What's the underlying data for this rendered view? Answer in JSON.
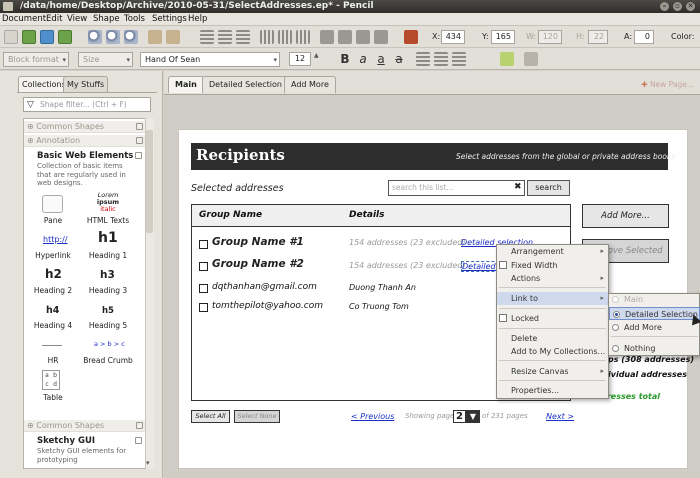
{
  "titlebar": {
    "title": "/data/home/Desktop/Archive/2010-05-31/SelectAddresses.ep* - Pencil"
  },
  "menubar": [
    "Document",
    "Edit",
    "View",
    "Shape",
    "Tools",
    "Settings",
    "Help"
  ],
  "toolbar": {
    "x_label": "X:",
    "x_value": "434",
    "y_label": "Y:",
    "y_value": "165",
    "w_label": "W:",
    "w_value": "120",
    "h_label": "H:",
    "h_value": "22",
    "a_label": "A:",
    "a_value": "0",
    "color_label": "Color:",
    "block_format": "Block format",
    "size": "Size",
    "font": "Hand Of Sean",
    "font_size": "12"
  },
  "left_panel": {
    "tabs": [
      "Collections",
      "My Stuffs"
    ],
    "filter_placeholder": "Shape filter... (Ctrl + F)",
    "categories": [
      "Common Shapes",
      "Annotation"
    ],
    "expanded": {
      "name": "Basic Web Elements",
      "desc": "Collection of basic items that are regularly used in web designs."
    },
    "shapes": [
      {
        "label": "Pane",
        "icon": "pane-icon"
      },
      {
        "label": "HTML Texts",
        "icon": "html-texts-icon",
        "preview": [
          "Lorem",
          "ipsum",
          "italic"
        ]
      },
      {
        "label": "Hyperlink",
        "icon": "hyperlink-icon",
        "preview": "http://"
      },
      {
        "label": "Heading 1",
        "icon": "heading-1-icon",
        "preview": "h1"
      },
      {
        "label": "Heading 2",
        "icon": "heading-2-icon",
        "preview": "h2"
      },
      {
        "label": "Heading 3",
        "icon": "heading-3-icon",
        "preview": "h3"
      },
      {
        "label": "Heading 4",
        "icon": "heading-4-icon",
        "preview": "h4"
      },
      {
        "label": "Heading 5",
        "icon": "heading-5-icon",
        "preview": "h5"
      },
      {
        "label": "HR",
        "icon": "hr-icon"
      },
      {
        "label": "Bread Crumb",
        "icon": "bread-crumb-icon",
        "preview": "a > b > c"
      },
      {
        "label": "Table",
        "icon": "table-icon",
        "preview": [
          "a",
          "b",
          "c",
          "d"
        ]
      }
    ],
    "bottom_categories": [
      "Common Shapes"
    ],
    "sketchy": {
      "name": "Sketchy GUI",
      "desc": "Sketchy GUI elements for prototyping"
    }
  },
  "page_tabs": [
    "Main",
    "Detailed Selection",
    "Add More"
  ],
  "new_page": "New Page...",
  "mockup": {
    "title": "Recipients",
    "subtitle": "Select addresses from the global or private address books",
    "selected_label": "Selected addresses",
    "search_placeholder": "search this list...",
    "search_clear": "✖",
    "search_button": "search",
    "col_group": "Group Name",
    "col_details": "Details",
    "rows": [
      {
        "name": "Group Name #1",
        "details": "154 addresses (23 excluded) -",
        "link": "Detailed selection"
      },
      {
        "name": "Group Name #2",
        "details": "154 addresses (23 excluded) -",
        "link": "Detailed selection"
      },
      {
        "name": "dqthanhan@gmail.com",
        "details": "Duong Thanh An"
      },
      {
        "name": "tomthepilot@yahoo.com",
        "details": "Co Truong Tom"
      }
    ],
    "add_more": "Add More...",
    "remove_selected": "Remove Selected",
    "total_partial_1": "ps (308 addresses)",
    "total_partial_2": "ividual addresses",
    "total_green": "addresses total",
    "select_all": "Select All",
    "select_none": "Select None",
    "previous": "< Previous",
    "showing_page": "Showing page",
    "page_num": "2",
    "of_pages": "of 231 pages",
    "next": "Next >"
  },
  "context_menu": {
    "items": [
      "Arrangement",
      "Fixed Width",
      "Actions",
      "Link to",
      "Locked",
      "Delete",
      "Add to My Collections...",
      "Resize Canvas",
      "Properties..."
    ]
  },
  "submenu": {
    "items": [
      "Main",
      "Detailed Selection",
      "Add More",
      "Nothing"
    ]
  },
  "colors": {
    "accent": "#3b6bb8",
    "menu_highlight": "#cfd9ee"
  }
}
